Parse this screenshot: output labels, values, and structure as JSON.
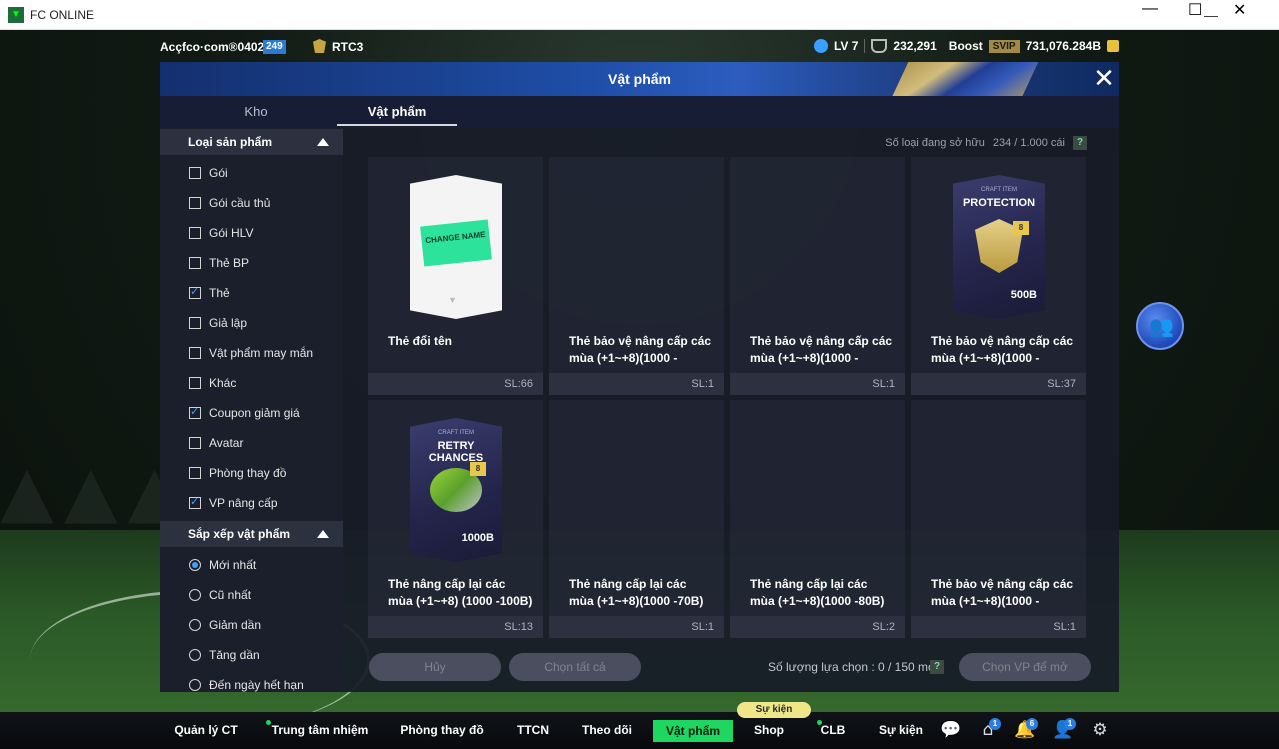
{
  "window": {
    "title": "FC ONLINE",
    "controls": {
      "minimize": "—",
      "maximize": "☐",
      "close": "✕"
    }
  },
  "userbar": {
    "username": "Acçfco·com®0402o",
    "level_badge": "249",
    "team": "RTC3",
    "lv": "LV 7",
    "fans": "232,291",
    "boost_label": "Boost",
    "svip": "SVIP",
    "bp": "731,076.284B"
  },
  "modal": {
    "title": "Vật phẩm",
    "close": "✕",
    "tabs": [
      {
        "label": "Kho"
      },
      {
        "label": "Vật phẩm",
        "active": true
      }
    ]
  },
  "sidebar": {
    "section1": {
      "title": "Loại sản phẩm",
      "items": [
        {
          "label": "Gói",
          "checked": false
        },
        {
          "label": "Gói cầu thủ",
          "checked": false
        },
        {
          "label": "Gói HLV",
          "checked": false
        },
        {
          "label": "Thẻ BP",
          "checked": false
        },
        {
          "label": "Thẻ",
          "checked": true
        },
        {
          "label": "Giả lập",
          "checked": false
        },
        {
          "label": "Vật phẩm may mắn",
          "checked": false
        },
        {
          "label": "Khác",
          "checked": false
        },
        {
          "label": "Coupon giảm giá",
          "checked": true
        },
        {
          "label": "Avatar",
          "checked": false
        },
        {
          "label": "Phòng thay đồ",
          "checked": false
        },
        {
          "label": "VP nâng cấp",
          "checked": true
        }
      ]
    },
    "section2": {
      "title": "Sắp xếp vật phẩm",
      "items": [
        {
          "label": "Mới nhất",
          "selected": true
        },
        {
          "label": "Cũ nhất",
          "selected": false
        },
        {
          "label": "Giảm dần",
          "selected": false
        },
        {
          "label": "Tăng dần",
          "selected": false
        },
        {
          "label": "Đến ngày hết hạn",
          "selected": false
        }
      ]
    }
  },
  "content": {
    "owned_label": "Số loại đang sở hữu",
    "owned_value": "234 / 1.000 cái",
    "help": "?",
    "cards": [
      {
        "name": "Thẻ đổi tên",
        "qty": "SL:66",
        "art": "change-name",
        "art_text": "CHANGE NAME"
      },
      {
        "name": "Thẻ bảo vệ nâng cấp các mùa (+1~+8)(1000 -",
        "qty": "SL:1",
        "art": "none"
      },
      {
        "name": "Thẻ bảo vệ nâng cấp các mùa (+1~+8)(1000 -",
        "qty": "SL:1",
        "art": "none"
      },
      {
        "name": "Thẻ bảo vệ nâng cấp các mùa (+1~+8)(1000 -",
        "qty": "SL:37",
        "art": "protection",
        "art_top": "CRAFT ITEM",
        "art_text": "PROTECTION",
        "art_badge": "8",
        "art_price": "500B"
      },
      {
        "name": "Thẻ nâng cấp lại các mùa (+1~+8) (1000 -100B)",
        "qty": "SL:13",
        "art": "retry",
        "art_top": "CRAFT ITEM",
        "art_text": "RETRY CHANCES",
        "art_badge": "8",
        "art_price": "1000B"
      },
      {
        "name": "Thẻ nâng cấp lại các mùa (+1~+8)(1000 -70B)",
        "qty": "SL:1",
        "art": "none"
      },
      {
        "name": "Thẻ nâng cấp lại các mùa (+1~+8)(1000 -80B)",
        "qty": "SL:2",
        "art": "none"
      },
      {
        "name": "Thẻ bảo vệ nâng cấp các mùa (+1~+8)(1000 -",
        "qty": "SL:1",
        "art": "none"
      }
    ],
    "cancel_label": "Hủy",
    "select_all_label": "Chọn tất cả",
    "selected_count": "Số lượng lựa chọn : 0 / 150 món",
    "open_label": "Chọn VP để mở"
  },
  "bottomnav": {
    "items": [
      {
        "label": "Quản lý CT"
      },
      {
        "label": "Trung tâm nhiệm vụ",
        "dot": true
      },
      {
        "label": "Phòng thay đồ"
      },
      {
        "label": "TTCN"
      },
      {
        "label": "Theo dõi"
      },
      {
        "label": "Vật phẩm",
        "active": true
      },
      {
        "label": "Shop"
      },
      {
        "label": "CLB",
        "dot": true
      },
      {
        "label": "Sự kiện"
      }
    ],
    "event_pill": "Sự kiện",
    "icons": [
      {
        "name": "chat-icon",
        "glyph": "💬"
      },
      {
        "name": "home-icon",
        "glyph": "⌂",
        "badge": "1"
      },
      {
        "name": "bell-icon",
        "glyph": "🔔",
        "badge": "6"
      },
      {
        "name": "friends-icon",
        "glyph": "👤",
        "badge": "1"
      },
      {
        "name": "gear-icon",
        "glyph": "⚙"
      }
    ]
  },
  "colors": {
    "accent_green": "#1ed760",
    "modal_header": "#1f4ea8",
    "checkbox_blue": "#3ca0ff"
  }
}
